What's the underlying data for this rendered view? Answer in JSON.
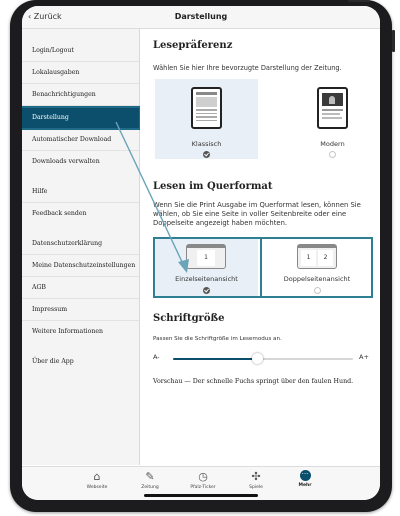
{
  "header": {
    "back_label": "Zurück",
    "title": "Darstellung"
  },
  "sidebar": {
    "items": [
      {
        "label": "Login/Logout"
      },
      {
        "label": "Lokalausgaben"
      },
      {
        "label": "Benachrichtigungen"
      },
      {
        "label": "Darstellung",
        "active": true
      },
      {
        "label": "Automatischer Download"
      },
      {
        "label": "Downloads verwalten"
      },
      {
        "label": "Hilfe"
      },
      {
        "label": "Feedback senden"
      },
      {
        "label": "Datenschutzerklärung"
      },
      {
        "label": "Meine Datenschutzeinstellungen"
      },
      {
        "label": "AGB"
      },
      {
        "label": "Impressum"
      },
      {
        "label": "Weitere Informationen"
      },
      {
        "label": "Über die App"
      }
    ]
  },
  "reading": {
    "heading": "Lesepräferenz",
    "description": "Wählen Sie hier Ihre bevorzugte Darstellung der Zeitung.",
    "options": [
      {
        "label": "Klassisch",
        "selected": true
      },
      {
        "label": "Modern",
        "selected": false
      }
    ]
  },
  "landscape": {
    "heading": "Lesen im Querformat",
    "description": "Wenn Sie die Print Ausgabe im Querformat lesen, können Sie wählen, ob Sie eine Seite in voller Seitenbreite oder eine Doppelseite angezeigt haben möchten.",
    "options": [
      {
        "label": "Einzelseitenansicht",
        "selected": true,
        "pages": [
          "1"
        ]
      },
      {
        "label": "Doppelseitenansicht",
        "selected": false,
        "pages": [
          "1",
          "2"
        ]
      }
    ]
  },
  "font_size": {
    "heading": "Schriftgröße",
    "description": "Passen Sie die Schriftgröße im Lesemodus an.",
    "min_label": "A-",
    "max_label": "A+",
    "value_fraction": 0.47,
    "preview": "Vorschau — Der schnelle Fuchs springt über den faulen Hund."
  },
  "bottom_nav": {
    "items": [
      {
        "label": "Webseite",
        "icon": "house-icon"
      },
      {
        "label": "Zeitung",
        "icon": "newspaper-icon"
      },
      {
        "label": "Pfalz-Ticker",
        "icon": "clock-icon"
      },
      {
        "label": "Spiele",
        "icon": "puzzle-icon"
      },
      {
        "label": "Mehr",
        "icon": "more-icon",
        "active": true
      }
    ]
  },
  "colors": {
    "accent": "#0b4f6c",
    "highlight_border": "#2f7f93",
    "arrow": "#6aa4b8"
  }
}
